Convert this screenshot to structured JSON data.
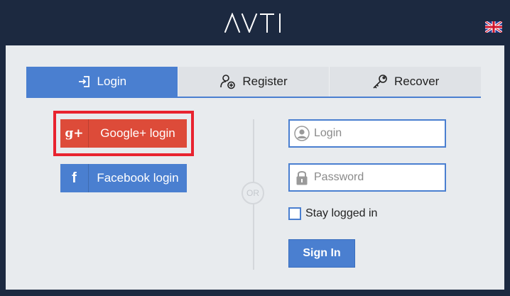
{
  "header": {
    "logo_text": "AVTI",
    "language_flag": "uk-flag-icon"
  },
  "tabs": [
    {
      "label": "Login",
      "icon": "login-arrow-icon",
      "active": true
    },
    {
      "label": "Register",
      "icon": "add-user-icon",
      "active": false
    },
    {
      "label": "Recover",
      "icon": "key-icon",
      "active": false
    }
  ],
  "social": {
    "google": {
      "icon_text": "g+",
      "label": "Google+ login"
    },
    "facebook": {
      "icon_text": "f",
      "label": "Facebook login"
    }
  },
  "divider_text": "OR",
  "form": {
    "login_placeholder": "Login",
    "password_placeholder": "Password",
    "stay_logged_in": "Stay logged in",
    "stay_checked": false,
    "signin_label": "Sign In"
  },
  "colors": {
    "background": "#1c2940",
    "panel": "#e8ebee",
    "accent": "#4a7fd0",
    "google": "#dd4b39",
    "highlight": "#e8232f"
  }
}
